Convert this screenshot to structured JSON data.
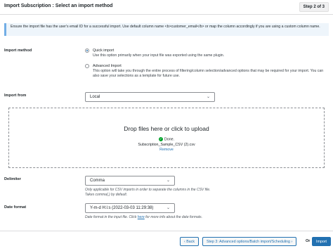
{
  "header": {
    "title": "Import Subscription : Select an import method",
    "step_badge": "Step 2 of 3"
  },
  "notice": {
    "text": "Ensure the import file has the user's email ID for a successful import. Use default column name <b>customer_email</b> or map the column accordingly if you are using a custom column name."
  },
  "import_method": {
    "label": "Import method",
    "options": [
      {
        "title": "Quick import",
        "desc": "Use this option primarily when your input file was exported using the same plugin.",
        "checked": true
      },
      {
        "title": "Advanced Import",
        "desc": "This option will take you through the entire process of filtering/column selection/advanced options that may be required for your import. You can also save your selections as a template for future use.",
        "checked": false
      }
    ]
  },
  "import_from": {
    "label": "Import from",
    "value": "Local"
  },
  "dropzone": {
    "title": "Drop files here or click to upload",
    "done": "Done.",
    "file_name": "Subscription_Sample_CSV (2).csv",
    "remove": "Remove"
  },
  "delimiter": {
    "label": "Delimiter",
    "value": "Comma",
    "help": "Only applicable for CSV imports in order to separate the columns in the CSV file. Takes comma(,) by default."
  },
  "date_format": {
    "label": "Date format",
    "value": "Y-m-d H:i:s (2022-03-03 11:29:38)",
    "help_prefix": "Date format in the input file. Click",
    "help_link": "here",
    "help_suffix": "for more info about the date formats."
  },
  "footer": {
    "back": "Back",
    "next": "Step 3: Advanced options/Batch import/Scheduling",
    "or": "Or",
    "import": "Import"
  }
}
